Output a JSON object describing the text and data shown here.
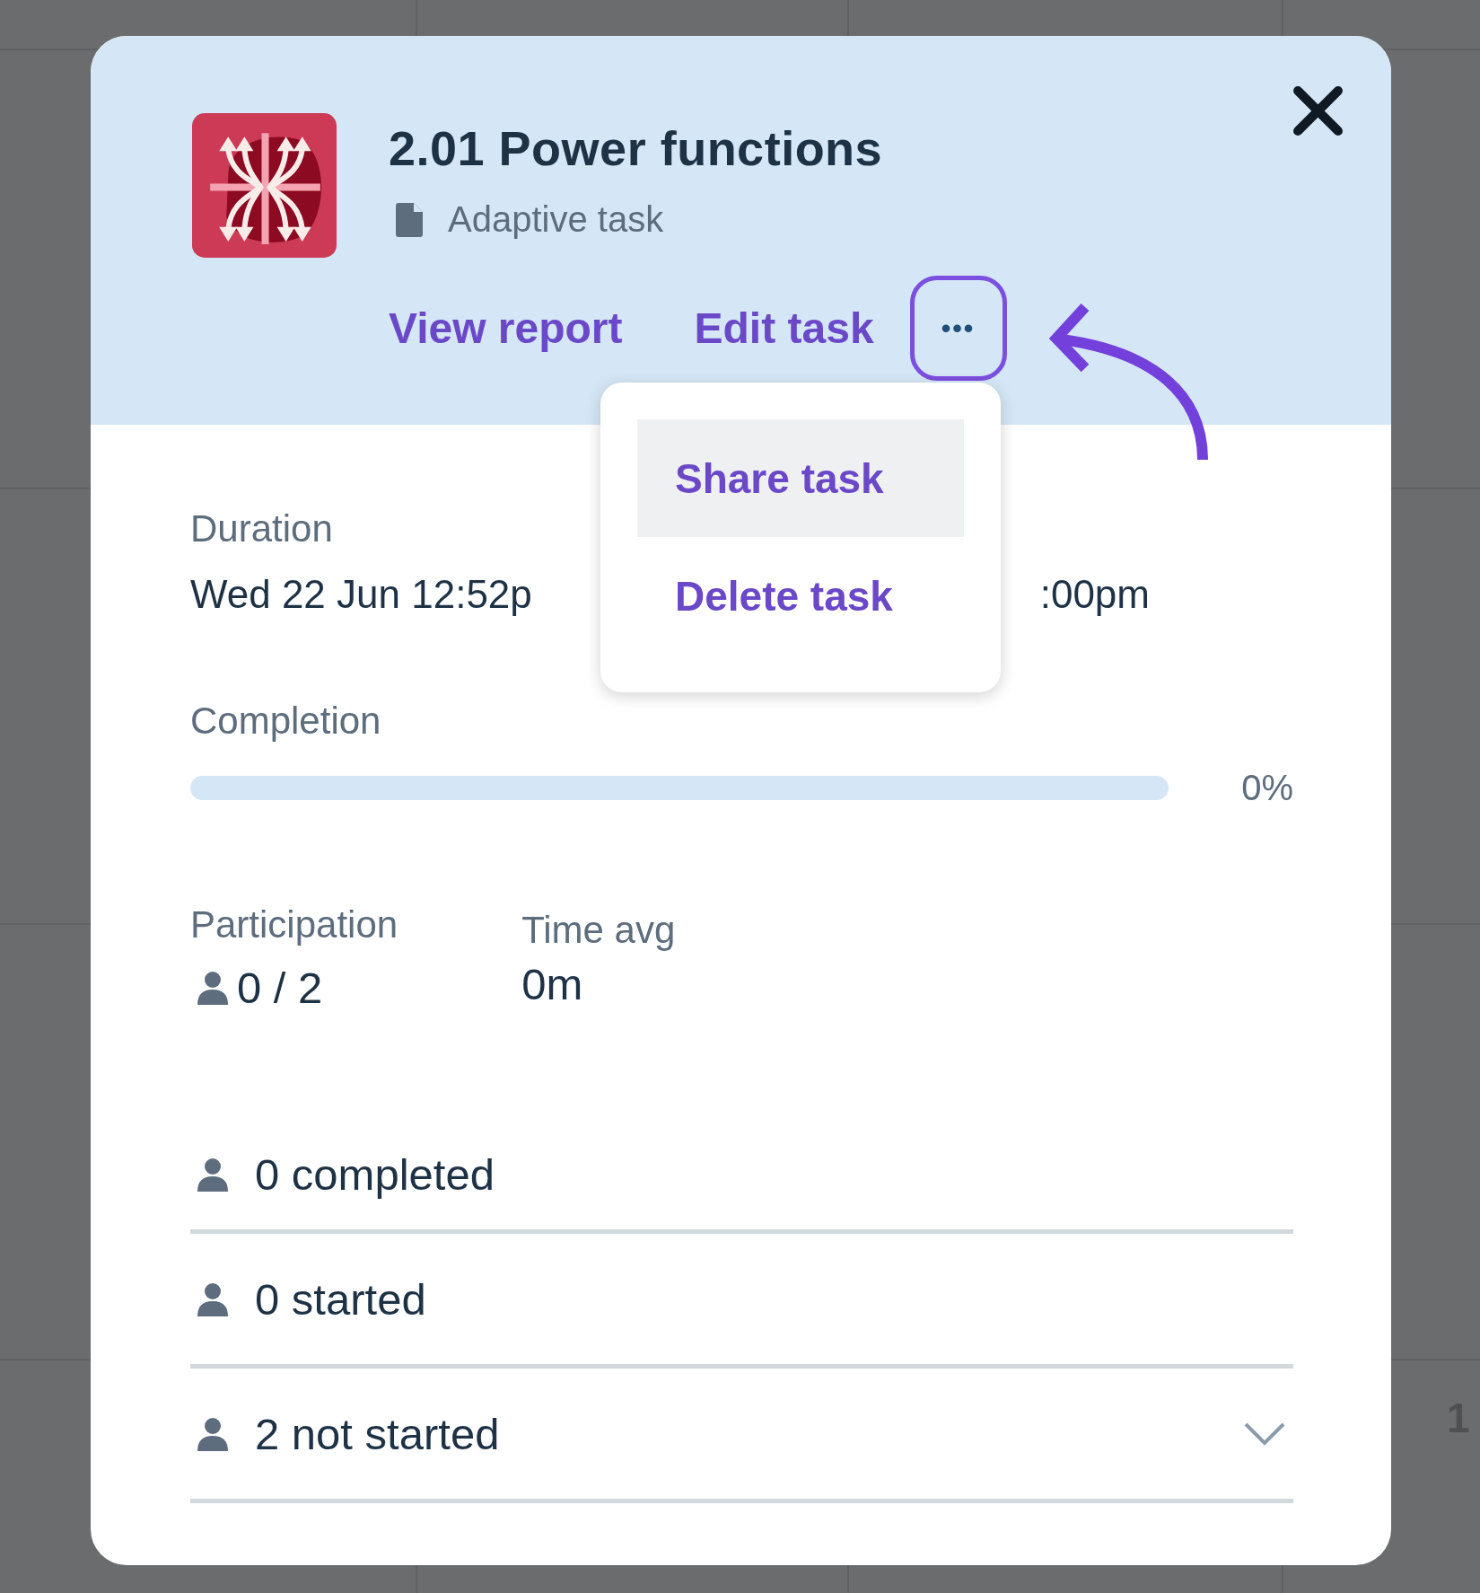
{
  "background": {
    "digits": [
      "1"
    ]
  },
  "task": {
    "title": "2.01 Power functions",
    "type": "Adaptive task"
  },
  "actions": [
    {
      "label": "View report"
    },
    {
      "label": "Edit task"
    }
  ],
  "more_button": {
    "label": "•••",
    "selected": true
  },
  "menu": [
    {
      "label": "Share task",
      "selected": true
    },
    {
      "label": "Delete task",
      "selected": false
    }
  ],
  "duration": {
    "label": "Duration",
    "value_start": "Wed 22 Jun 12:52p",
    "value_end": ":00pm"
  },
  "completion": {
    "label": "Completion",
    "level": 0,
    "reading": "0%"
  },
  "participation": {
    "label": "Participation",
    "value": "0 / 2"
  },
  "time_avg": {
    "label": "Time avg",
    "value": "0m"
  },
  "status_rows": [
    {
      "label": "0 completed",
      "expandable": false
    },
    {
      "label": "0 started",
      "expandable": false
    },
    {
      "label": "2 not started",
      "expandable": true
    }
  ]
}
